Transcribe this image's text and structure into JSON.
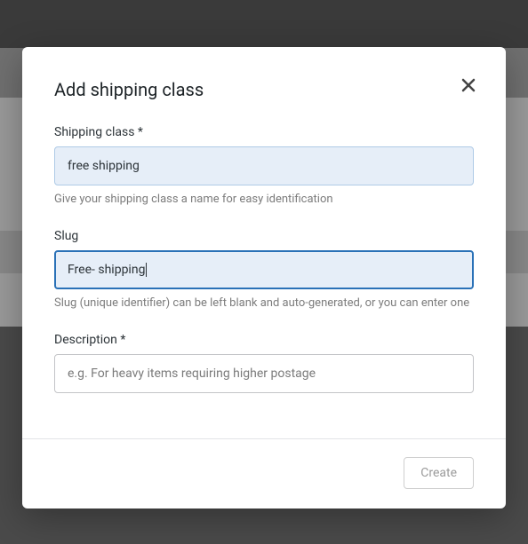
{
  "modal": {
    "title": "Add shipping class",
    "close_aria": "Close"
  },
  "fields": {
    "shipping_class": {
      "label": "Shipping class *",
      "value": "free shipping",
      "help": "Give your shipping class a name for easy identification"
    },
    "slug": {
      "label": "Slug",
      "value": "Free- shipping",
      "help": "Slug (unique identifier) can be left blank and auto-generated, or you can enter one"
    },
    "description": {
      "label": "Description *",
      "placeholder": "e.g. For heavy items requiring higher postage",
      "value": ""
    }
  },
  "footer": {
    "create_label": "Create"
  }
}
